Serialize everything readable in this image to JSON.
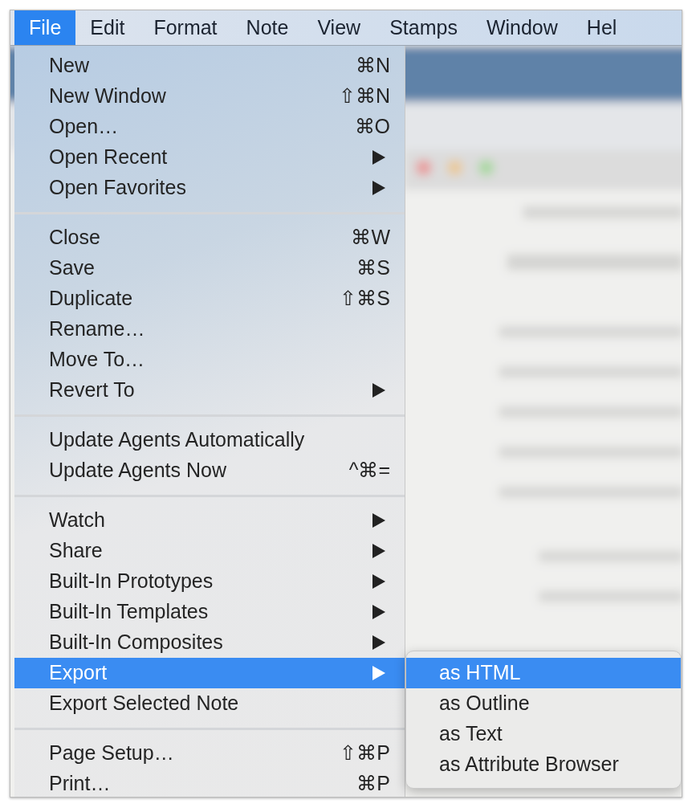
{
  "menu_bar": [
    {
      "label": "File",
      "selected": true
    },
    {
      "label": "Edit",
      "selected": false
    },
    {
      "label": "Format",
      "selected": false
    },
    {
      "label": "Note",
      "selected": false
    },
    {
      "label": "View",
      "selected": false
    },
    {
      "label": "Stamps",
      "selected": false
    },
    {
      "label": "Window",
      "selected": false
    },
    {
      "label": "Hel",
      "selected": false
    }
  ],
  "file_menu": {
    "groups": [
      {
        "items": [
          {
            "label": "New",
            "shortcut": "⌘N",
            "has_submenu": false,
            "selected": false
          },
          {
            "label": "New Window",
            "shortcut": "⇧⌘N",
            "has_submenu": false,
            "selected": false
          },
          {
            "label": "Open…",
            "shortcut": "⌘O",
            "has_submenu": false,
            "selected": false
          },
          {
            "label": "Open Recent",
            "has_submenu": true,
            "selected": false
          },
          {
            "label": "Open Favorites",
            "has_submenu": true,
            "selected": false
          }
        ]
      },
      {
        "items": [
          {
            "label": "Close",
            "shortcut": "⌘W",
            "has_submenu": false,
            "selected": false
          },
          {
            "label": "Save",
            "shortcut": "⌘S",
            "has_submenu": false,
            "selected": false
          },
          {
            "label": "Duplicate",
            "shortcut": "⇧⌘S",
            "has_submenu": false,
            "selected": false
          },
          {
            "label": "Rename…",
            "has_submenu": false,
            "selected": false
          },
          {
            "label": "Move To…",
            "has_submenu": false,
            "selected": false
          },
          {
            "label": "Revert To",
            "has_submenu": true,
            "selected": false
          }
        ]
      },
      {
        "items": [
          {
            "label": "Update Agents Automatically",
            "has_submenu": false,
            "selected": false
          },
          {
            "label": "Update Agents Now",
            "shortcut": "^⌘=",
            "has_submenu": false,
            "selected": false
          }
        ]
      },
      {
        "items": [
          {
            "label": "Watch",
            "has_submenu": true,
            "selected": false
          },
          {
            "label": "Share",
            "has_submenu": true,
            "selected": false
          },
          {
            "label": "Built-In Prototypes",
            "has_submenu": true,
            "selected": false
          },
          {
            "label": "Built-In Templates",
            "has_submenu": true,
            "selected": false
          },
          {
            "label": "Built-In Composites",
            "has_submenu": true,
            "selected": false
          },
          {
            "label": "Export",
            "has_submenu": true,
            "selected": true
          },
          {
            "label": "Export Selected Note",
            "has_submenu": false,
            "selected": false
          }
        ]
      },
      {
        "items": [
          {
            "label": "Page Setup…",
            "shortcut": "⇧⌘P",
            "has_submenu": false,
            "selected": false
          },
          {
            "label": "Print…",
            "shortcut": "⌘P",
            "has_submenu": false,
            "selected": false
          }
        ]
      }
    ]
  },
  "export_submenu": {
    "items": [
      {
        "label": "as HTML",
        "selected": true
      },
      {
        "label": "as Outline",
        "selected": false
      },
      {
        "label": "as Text",
        "selected": false
      },
      {
        "label": "as Attribute Browser",
        "selected": false
      }
    ]
  }
}
